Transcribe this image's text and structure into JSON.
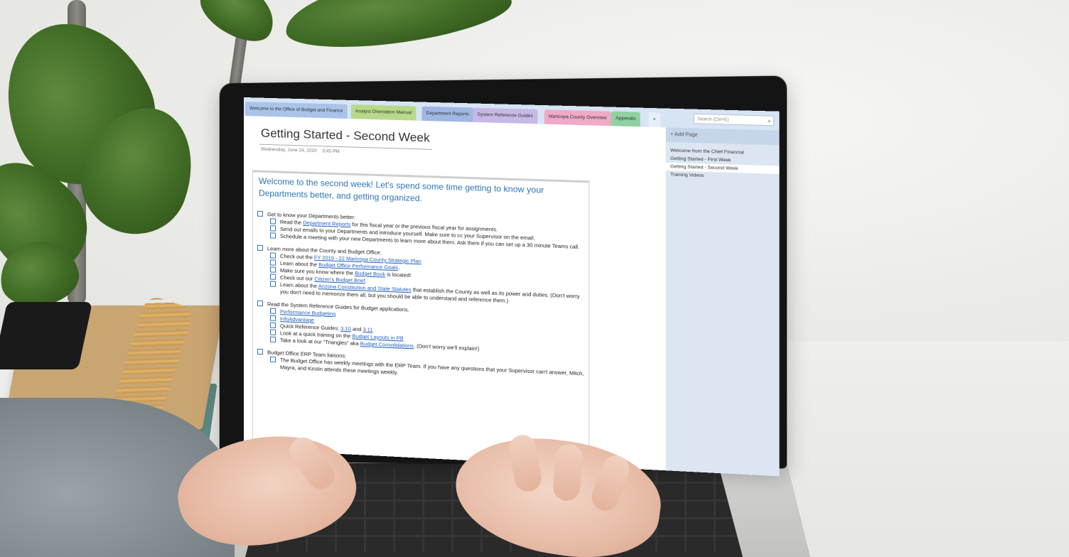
{
  "notebook_tabs": [
    {
      "label": "Welcome to the Office of Budget and Finance",
      "color": "#a9c4e8"
    },
    {
      "label": "Analyst Orientation Manual",
      "color": "#b8d98a"
    },
    {
      "label": "Department Reports",
      "color": "#9fb7e3"
    },
    {
      "label": "System Reference Guides",
      "color": "#c8b8e6"
    },
    {
      "label": "Maricopa County Overview",
      "color": "#f0a9c8"
    },
    {
      "label": "Appendix",
      "color": "#8fd1a0"
    },
    {
      "label": "+",
      "color": "#e8eef7"
    }
  ],
  "search": {
    "placeholder": "Search (Ctrl+E)"
  },
  "sidebar": {
    "add_page": "+ Add Page",
    "pages": [
      {
        "label": "Welcome from the Chief Financial",
        "selected": false
      },
      {
        "label": "Getting Started - First Week",
        "selected": false
      },
      {
        "label": "Getting Started - Second Week",
        "selected": true
      },
      {
        "label": "Training Videos",
        "selected": false
      }
    ]
  },
  "page": {
    "title": "Getting Started - Second Week",
    "date": "Wednesday, June 24, 2020",
    "time": "3:45 PM",
    "intro": "Welcome to the second week! Let's spend some time getting to know your Departments better, and getting organized."
  },
  "checklist": [
    {
      "level": 0,
      "parts": [
        {
          "t": "Get to know your Departments better:"
        }
      ]
    },
    {
      "level": 1,
      "parts": [
        {
          "t": "Read the "
        },
        {
          "t": "Department Reports",
          "link": true
        },
        {
          "t": " for this fiscal year or the previous fiscal year for assignments."
        }
      ]
    },
    {
      "level": 1,
      "parts": [
        {
          "t": "Send out emails to your Departments and introduce yourself. Make sure to cc your Supervisor on the email."
        }
      ]
    },
    {
      "level": 1,
      "parts": [
        {
          "t": "Schedule a meeting with your new Departments to learn more about them. Ask them if you can set up a 30 minute Teams call."
        }
      ]
    },
    {
      "level": 0,
      "parts": [
        {
          "t": "Learn more about the County and Budget Office:"
        }
      ]
    },
    {
      "level": 1,
      "parts": [
        {
          "t": "Check out the "
        },
        {
          "t": "FY 2019 - 22 Maricopa County Strategic Plan",
          "link": true
        }
      ]
    },
    {
      "level": 1,
      "parts": [
        {
          "t": "Learn about the "
        },
        {
          "t": "Budget Office Performance Goals",
          "link": true
        },
        {
          "t": "."
        }
      ]
    },
    {
      "level": 1,
      "parts": [
        {
          "t": "Make sure you know where the "
        },
        {
          "t": "Budget Book",
          "link": true
        },
        {
          "t": " is located!"
        }
      ]
    },
    {
      "level": 1,
      "parts": [
        {
          "t": "Check out our "
        },
        {
          "t": "Citizen's Budget Brief",
          "link": true
        },
        {
          "t": "."
        }
      ]
    },
    {
      "level": 1,
      "parts": [
        {
          "t": "Learn about the "
        },
        {
          "t": "Arizona Constitution and State Statutes",
          "link": true
        },
        {
          "t": " that establish the County as well as its power and duties. (Don't worry you don't need to memorize them all, but you should be able to understand and reference them.)"
        }
      ]
    },
    {
      "level": 0,
      "parts": [
        {
          "t": "Read the System Reference Guides for Budget applications."
        }
      ]
    },
    {
      "level": 1,
      "parts": [
        {
          "t": "Performance Budgeting",
          "link": true
        }
      ]
    },
    {
      "level": 1,
      "parts": [
        {
          "t": "InfoAdvantage",
          "link": true
        }
      ]
    },
    {
      "level": 1,
      "parts": [
        {
          "t": "Quick Reference Guides: "
        },
        {
          "t": "3.10",
          "link": true
        },
        {
          "t": " and "
        },
        {
          "t": "3.11",
          "link": true
        }
      ]
    },
    {
      "level": 1,
      "parts": [
        {
          "t": "Look at a quick training on the "
        },
        {
          "t": "Budget Layouts in PB",
          "link": true
        }
      ]
    },
    {
      "level": 1,
      "parts": [
        {
          "t": "Take a look at our \"Triangles\" aka "
        },
        {
          "t": "Budget Consolidations",
          "link": true
        },
        {
          "t": ". (Don't worry we'll explain!)"
        }
      ]
    },
    {
      "level": 0,
      "parts": [
        {
          "t": "Budget Office ERP Team liaisons:"
        }
      ]
    },
    {
      "level": 1,
      "parts": [
        {
          "t": "The Budget Office has weekly meetings with the ERP Team. If you have any questions that your Supervisor can't answer, Mitch, Mayra, and Kirstin attends these meetings weekly."
        }
      ]
    }
  ]
}
